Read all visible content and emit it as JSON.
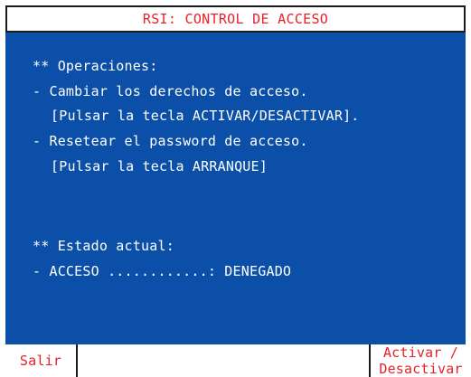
{
  "header": {
    "title": "RSI: CONTROL DE ACCESO"
  },
  "body": {
    "lines": [
      "** Operaciones:",
      "- Cambiar los derechos de acceso.",
      "[Pulsar la tecla ACTIVAR/DESACTIVAR].",
      "- Resetear el password de acceso.",
      "[Pulsar la tecla ARRANQUE]",
      "** Estado actual:",
      "- ACCESO ............: DENEGADO"
    ]
  },
  "softkeys": {
    "left_label": "Salir",
    "right_label_line1": "Activar /",
    "right_label_line2": "Desactivar"
  },
  "colors": {
    "screen_background": "#0b4fa8",
    "body_text": "#ffffff",
    "accent_text": "#e8202a",
    "border": "#1a1a1a"
  }
}
